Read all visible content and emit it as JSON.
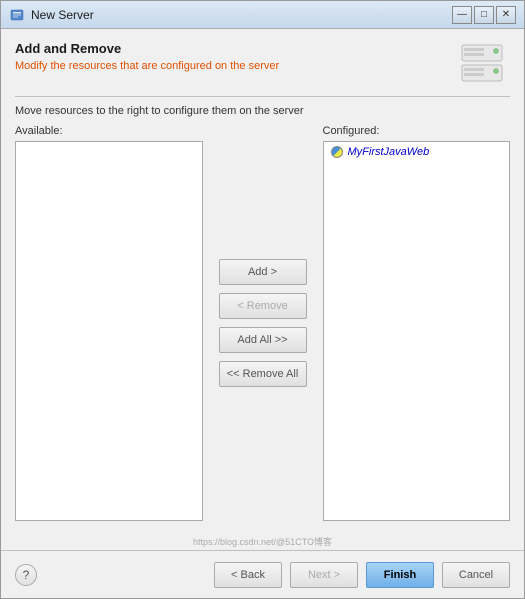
{
  "window": {
    "title": "New Server",
    "controls": {
      "minimize": "—",
      "maximize": "□",
      "close": "✕"
    }
  },
  "header": {
    "title": "Add and Remove",
    "subtitle": "Modify the resources that are configured on the server",
    "instruction": "Move resources to the right to configure them on the server"
  },
  "panels": {
    "available_label": "Available:",
    "configured_label": "Configured:",
    "configured_items": [
      {
        "name": "MyFirstJavaWeb",
        "icon": "web-icon"
      }
    ]
  },
  "buttons": {
    "add": "Add >",
    "remove": "< Remove",
    "add_all": "Add All >>",
    "remove_all": "<< Remove All"
  },
  "footer": {
    "help": "?",
    "back": "< Back",
    "next": "Next >",
    "finish": "Finish",
    "cancel": "Cancel"
  },
  "watermark": "https://blog.csdn.net/@51CTO博客"
}
